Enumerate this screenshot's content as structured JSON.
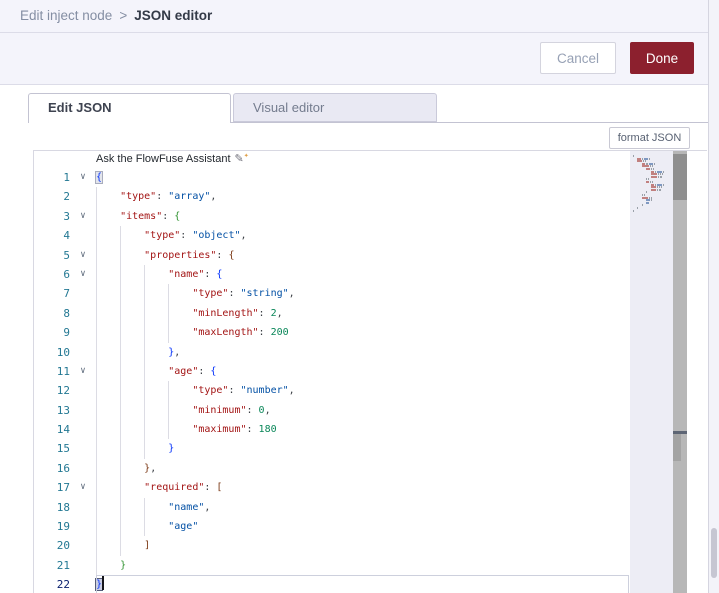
{
  "breadcrumb": {
    "parent": "Edit inject node",
    "separator": ">",
    "current": "JSON editor"
  },
  "buttons": {
    "cancel": "Cancel",
    "done": "Done"
  },
  "tabs": [
    {
      "label": "Edit JSON",
      "active": true
    },
    {
      "label": "Visual editor",
      "active": false
    }
  ],
  "format_button": "format JSON",
  "assistant_hint": "Ask the FlowFuse Assistant",
  "icons": {
    "fold_chevron": "∨",
    "pencil": "✎",
    "spark": "✦"
  },
  "colors": {
    "done": "#8C202E",
    "key": "#A31515",
    "str": "#0451A5",
    "num": "#098658",
    "b1": "#0431FA",
    "b2": "#319331",
    "b3": "#7B3814",
    "ln": "#237893"
  },
  "editor": {
    "language": "json",
    "cursor_line": 22,
    "lines": [
      {
        "n": 1,
        "fold": true,
        "ind": 0,
        "box": "open",
        "tok": [
          [
            "b1",
            "{"
          ]
        ]
      },
      {
        "n": 2,
        "fold": false,
        "ind": 1,
        "tok": [
          [
            "key",
            "\"type\""
          ],
          [
            "pun",
            ": "
          ],
          [
            "str",
            "\"array\""
          ],
          [
            "pun",
            ","
          ]
        ]
      },
      {
        "n": 3,
        "fold": true,
        "ind": 1,
        "tok": [
          [
            "key",
            "\"items\""
          ],
          [
            "pun",
            ": "
          ],
          [
            "b2",
            "{"
          ]
        ]
      },
      {
        "n": 4,
        "fold": false,
        "ind": 2,
        "tok": [
          [
            "key",
            "\"type\""
          ],
          [
            "pun",
            ": "
          ],
          [
            "str",
            "\"object\""
          ],
          [
            "pun",
            ","
          ]
        ]
      },
      {
        "n": 5,
        "fold": true,
        "ind": 2,
        "tok": [
          [
            "key",
            "\"properties\""
          ],
          [
            "pun",
            ": "
          ],
          [
            "b3",
            "{"
          ]
        ]
      },
      {
        "n": 6,
        "fold": true,
        "ind": 3,
        "tok": [
          [
            "key",
            "\"name\""
          ],
          [
            "pun",
            ": "
          ],
          [
            "b1",
            "{"
          ]
        ]
      },
      {
        "n": 7,
        "fold": false,
        "ind": 4,
        "tok": [
          [
            "key",
            "\"type\""
          ],
          [
            "pun",
            ": "
          ],
          [
            "str",
            "\"string\""
          ],
          [
            "pun",
            ","
          ]
        ]
      },
      {
        "n": 8,
        "fold": false,
        "ind": 4,
        "tok": [
          [
            "key",
            "\"minLength\""
          ],
          [
            "pun",
            ": "
          ],
          [
            "num",
            "2"
          ],
          [
            "pun",
            ","
          ]
        ]
      },
      {
        "n": 9,
        "fold": false,
        "ind": 4,
        "tok": [
          [
            "key",
            "\"maxLength\""
          ],
          [
            "pun",
            ": "
          ],
          [
            "num",
            "200"
          ]
        ]
      },
      {
        "n": 10,
        "fold": false,
        "ind": 3,
        "tok": [
          [
            "b1",
            "}"
          ],
          [
            "pun",
            ","
          ]
        ]
      },
      {
        "n": 11,
        "fold": true,
        "ind": 3,
        "tok": [
          [
            "key",
            "\"age\""
          ],
          [
            "pun",
            ": "
          ],
          [
            "b1",
            "{"
          ]
        ]
      },
      {
        "n": 12,
        "fold": false,
        "ind": 4,
        "tok": [
          [
            "key",
            "\"type\""
          ],
          [
            "pun",
            ": "
          ],
          [
            "str",
            "\"number\""
          ],
          [
            "pun",
            ","
          ]
        ]
      },
      {
        "n": 13,
        "fold": false,
        "ind": 4,
        "tok": [
          [
            "key",
            "\"minimum\""
          ],
          [
            "pun",
            ": "
          ],
          [
            "num",
            "0"
          ],
          [
            "pun",
            ","
          ]
        ]
      },
      {
        "n": 14,
        "fold": false,
        "ind": 4,
        "tok": [
          [
            "key",
            "\"maximum\""
          ],
          [
            "pun",
            ": "
          ],
          [
            "num",
            "180"
          ]
        ]
      },
      {
        "n": 15,
        "fold": false,
        "ind": 3,
        "tok": [
          [
            "b1",
            "}"
          ]
        ]
      },
      {
        "n": 16,
        "fold": false,
        "ind": 2,
        "tok": [
          [
            "b3",
            "}"
          ],
          [
            "pun",
            ","
          ]
        ]
      },
      {
        "n": 17,
        "fold": true,
        "ind": 2,
        "tok": [
          [
            "key",
            "\"required\""
          ],
          [
            "pun",
            ": "
          ],
          [
            "b3",
            "["
          ]
        ]
      },
      {
        "n": 18,
        "fold": false,
        "ind": 3,
        "tok": [
          [
            "str",
            "\"name\""
          ],
          [
            "pun",
            ","
          ]
        ]
      },
      {
        "n": 19,
        "fold": false,
        "ind": 3,
        "tok": [
          [
            "str",
            "\"age\""
          ]
        ]
      },
      {
        "n": 20,
        "fold": false,
        "ind": 2,
        "tok": [
          [
            "b3",
            "]"
          ]
        ]
      },
      {
        "n": 21,
        "fold": false,
        "ind": 1,
        "tok": [
          [
            "b2",
            "}"
          ]
        ]
      },
      {
        "n": 22,
        "fold": false,
        "ind": 0,
        "box": "close",
        "cursor": true,
        "current": true,
        "tok": [
          [
            "b1",
            "}"
          ]
        ]
      }
    ]
  }
}
